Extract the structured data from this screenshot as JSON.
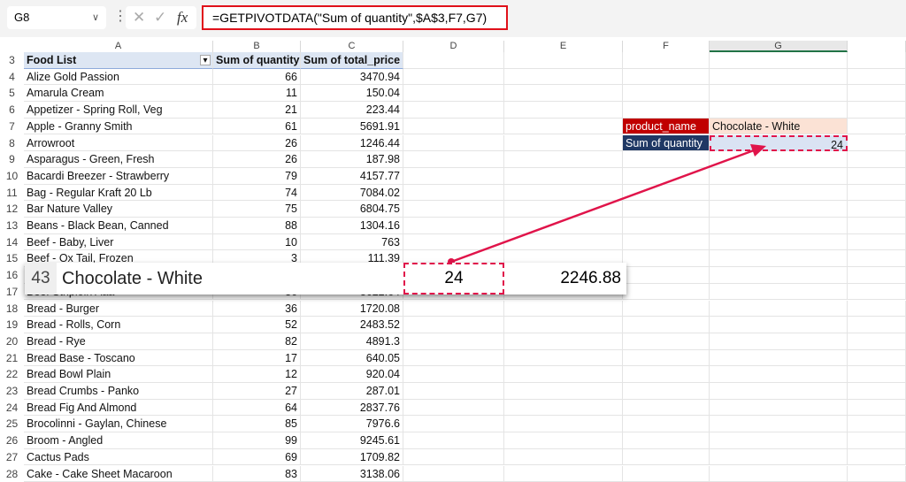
{
  "formula_bar": {
    "name_box": "G8",
    "formula": "=GETPIVOTDATA(\"Sum of quantity\",$A$3,F7,G7)",
    "fx_label": "fx"
  },
  "columns": [
    "A",
    "B",
    "C",
    "D",
    "E",
    "F",
    "G"
  ],
  "pivot": {
    "header": {
      "row": "3",
      "label": "Food List",
      "col_b": "Sum of quantity",
      "col_c": "Sum of total_price"
    },
    "rows": [
      {
        "row": "4",
        "name": "Alize Gold Passion",
        "qty": "66",
        "price": "3470.94"
      },
      {
        "row": "5",
        "name": "Amarula Cream",
        "qty": "11",
        "price": "150.04"
      },
      {
        "row": "6",
        "name": "Appetizer - Spring Roll, Veg",
        "qty": "21",
        "price": "223.44"
      },
      {
        "row": "7",
        "name": "Apple - Granny Smith",
        "qty": "61",
        "price": "5691.91"
      },
      {
        "row": "8",
        "name": "Arrowroot",
        "qty": "26",
        "price": "1246.44"
      },
      {
        "row": "9",
        "name": "Asparagus - Green, Fresh",
        "qty": "26",
        "price": "187.98"
      },
      {
        "row": "10",
        "name": "Bacardi Breezer - Strawberry",
        "qty": "79",
        "price": "4157.77"
      },
      {
        "row": "11",
        "name": "Bag - Regular Kraft 20 Lb",
        "qty": "74",
        "price": "7084.02"
      },
      {
        "row": "12",
        "name": "Bar Nature Valley",
        "qty": "75",
        "price": "6804.75"
      },
      {
        "row": "13",
        "name": "Beans - Black Bean, Canned",
        "qty": "88",
        "price": "1304.16"
      },
      {
        "row": "14",
        "name": "Beef - Baby, Liver",
        "qty": "10",
        "price": "763"
      },
      {
        "row": "15",
        "name": "Beef - Ox Tail, Frozen",
        "qty": "3",
        "price": "111.39"
      },
      {
        "row": "16",
        "name": "",
        "qty": "",
        "price": ""
      },
      {
        "row": "17",
        "name": "Beef Striploin Aaa",
        "qty": "36",
        "price": "3622.64"
      },
      {
        "row": "18",
        "name": "Bread - Burger",
        "qty": "36",
        "price": "1720.08"
      },
      {
        "row": "19",
        "name": "Bread - Rolls, Corn",
        "qty": "52",
        "price": "2483.52"
      },
      {
        "row": "20",
        "name": "Bread - Rye",
        "qty": "82",
        "price": "4891.3"
      },
      {
        "row": "21",
        "name": "Bread Base - Toscano",
        "qty": "17",
        "price": "640.05"
      },
      {
        "row": "22",
        "name": "Bread Bowl Plain",
        "qty": "12",
        "price": "920.04"
      },
      {
        "row": "23",
        "name": "Bread Crumbs - Panko",
        "qty": "27",
        "price": "287.01"
      },
      {
        "row": "24",
        "name": "Bread Fig And Almond",
        "qty": "64",
        "price": "2837.76"
      },
      {
        "row": "25",
        "name": "Brocolinni - Gaylan, Chinese",
        "qty": "85",
        "price": "7976.6"
      },
      {
        "row": "26",
        "name": "Broom - Angled",
        "qty": "99",
        "price": "9245.61"
      },
      {
        "row": "27",
        "name": "Cactus Pads",
        "qty": "69",
        "price": "1709.82"
      },
      {
        "row": "28",
        "name": "Cake - Cake Sheet Macaroon",
        "qty": "83",
        "price": "3138.06"
      }
    ]
  },
  "lookup": {
    "f7": "product_name",
    "g7": "Chocolate - White",
    "f8": "Sum of quantity",
    "g8": "24",
    "label_color": "#c00000",
    "label2_color": "#1f3864"
  },
  "callout": {
    "row": "43",
    "name": "Chocolate - White",
    "qty": "24",
    "price": "2246.88"
  },
  "accent_color": "#e0144a"
}
